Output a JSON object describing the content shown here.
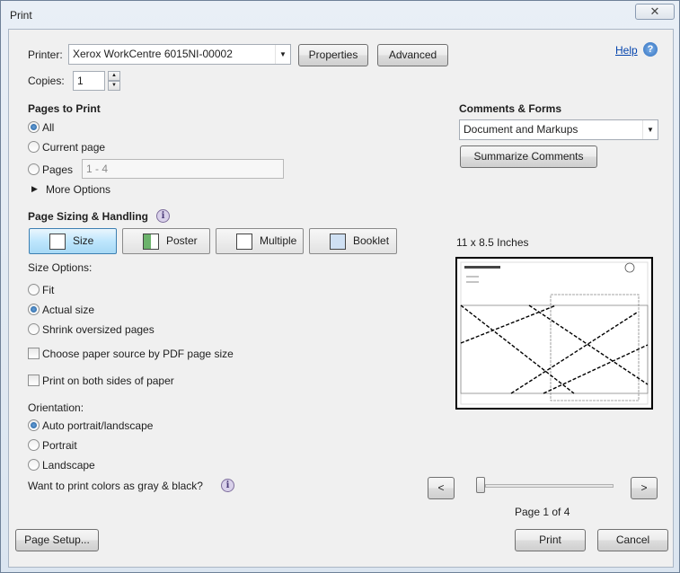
{
  "window": {
    "title": "Print",
    "close_glyph": "✕"
  },
  "printer": {
    "label": "Printer:",
    "selected": "Xerox WorkCentre 6015NI-00002",
    "properties_label": "Properties",
    "advanced_label": "Advanced"
  },
  "copies": {
    "label": "Copies:",
    "value": "1"
  },
  "help": {
    "link": "Help",
    "icon": "?"
  },
  "pages_to_print": {
    "title": "Pages to Print",
    "all": "All",
    "current": "Current page",
    "pages": "Pages",
    "pages_value": "1 - 4",
    "more_options": "More Options"
  },
  "comments": {
    "title": "Comments & Forms",
    "selected": "Document and Markups",
    "summarize_label": "Summarize Comments"
  },
  "sizing": {
    "title": "Page Sizing & Handling",
    "tabs": [
      "Size",
      "Poster",
      "Multiple",
      "Booklet"
    ],
    "size_options_label": "Size Options:",
    "fit": "Fit",
    "actual": "Actual size",
    "shrink": "Shrink oversized pages",
    "paper_source": "Choose paper source by PDF page size",
    "both_sides": "Print on both sides of paper"
  },
  "orientation": {
    "label": "Orientation:",
    "auto": "Auto portrait/landscape",
    "portrait": "Portrait",
    "landscape": "Landscape"
  },
  "gray_question": "Want to print colors as gray & black?",
  "preview": {
    "size_text": "11 x 8.5 Inches",
    "page_info": "Page 1 of 4",
    "prev": "<",
    "next": ">",
    "slider_fraction": 0
  },
  "footer": {
    "page_setup": "Page Setup...",
    "print": "Print",
    "cancel": "Cancel"
  },
  "colors": {
    "accent": "#3c7fb1",
    "window_bg": "#f0f0f0"
  }
}
